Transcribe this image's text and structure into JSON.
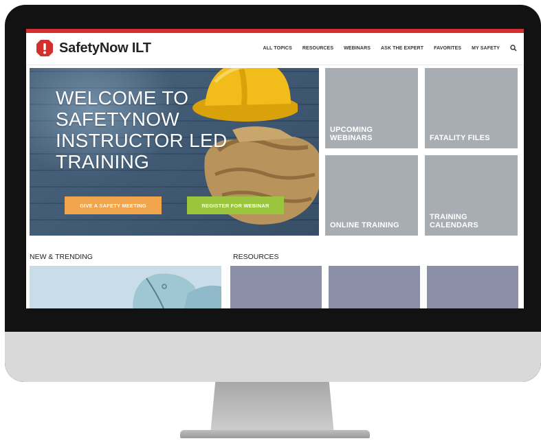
{
  "brand": {
    "name": "SafetyNow",
    "suffix": "ILT",
    "accent_color": "#d32f2f"
  },
  "nav": {
    "items": [
      "ALL TOPICS",
      "RESOURCES",
      "WEBINARS",
      "ASK THE EXPERT",
      "FAVORITES",
      "MY SAFETY"
    ],
    "search_icon": "search-icon"
  },
  "hero": {
    "title": "WELCOME TO SAFETYNOW INSTRUCTOR LED TRAINING",
    "primary_button": "GIVE A SAFETY MEETING",
    "primary_button_color": "#f0a44b",
    "secondary_button": "REGISTER FOR WEBINAR",
    "secondary_button_color": "#9bc53d"
  },
  "tiles": [
    {
      "label": "UPCOMING WEBINARS"
    },
    {
      "label": "FATALITY FILES"
    },
    {
      "label": "ONLINE TRAINING"
    },
    {
      "label": "TRAINING CALENDARS"
    }
  ],
  "sections": {
    "new_trending": "NEW & TRENDING",
    "resources": "RESOURCES"
  }
}
